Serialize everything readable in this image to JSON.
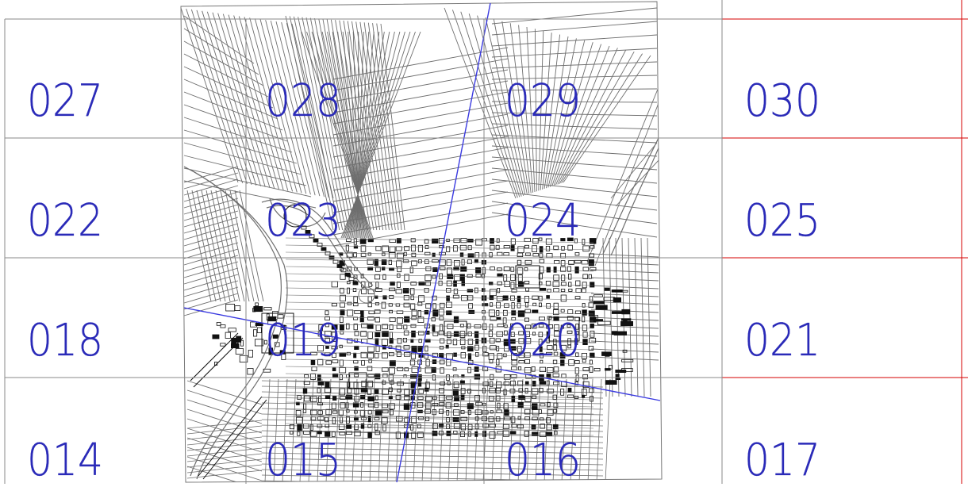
{
  "sheet_index": {
    "rows": [
      [
        "027",
        "028",
        "029",
        "030"
      ],
      [
        "022",
        "023",
        "024",
        "025"
      ],
      [
        "018",
        "019",
        "020",
        "021"
      ],
      [
        "014",
        "015",
        "016",
        "017"
      ]
    ]
  },
  "colors": {
    "background": "#ffffff",
    "grid_gray": "#8a8a8a",
    "grid_red": "#d40000",
    "label_blue": "#2a2ab8",
    "street_gray": "#6e6e6e",
    "building_black": "#111111",
    "road_blue": "#3a3ae0"
  }
}
